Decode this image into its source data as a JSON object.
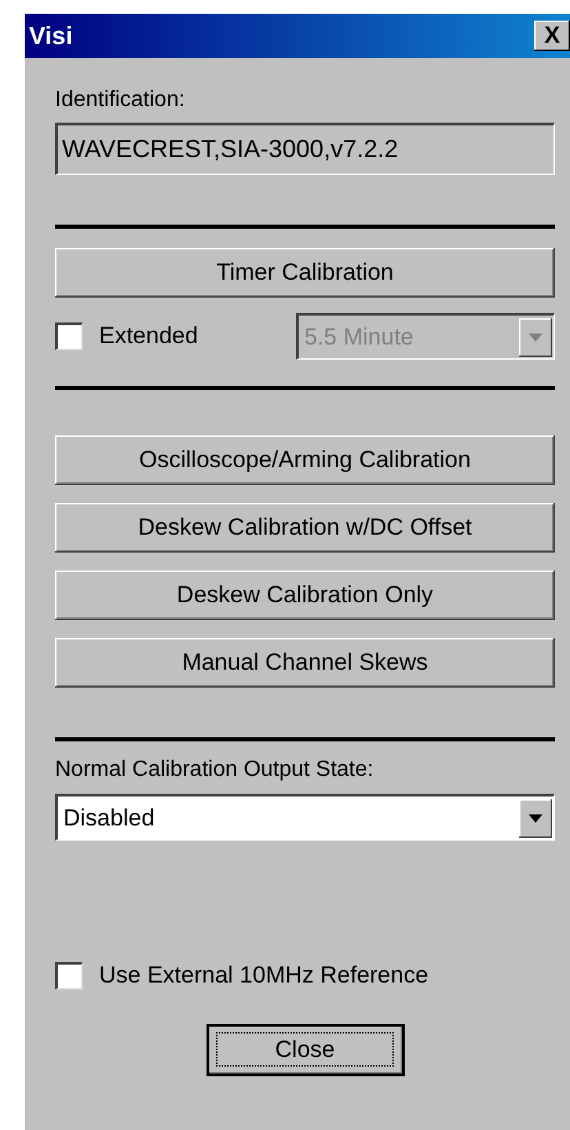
{
  "window": {
    "title": "Visi",
    "close_glyph": "X"
  },
  "identification": {
    "label": "Identification:",
    "value": "WAVECREST,SIA-3000,v7.2.2"
  },
  "timer_button": "Timer Calibration",
  "extended": {
    "label": "Extended",
    "checked": false
  },
  "duration": {
    "value": "5.5 Minute",
    "disabled": true
  },
  "calibration_buttons": [
    "Oscilloscope/Arming Calibration",
    "Deskew Calibration w/DC Offset",
    "Deskew Calibration Only",
    "Manual Channel Skews"
  ],
  "output_state": {
    "label": "Normal Calibration Output State:",
    "value": "Disabled",
    "disabled": false
  },
  "external_reference": {
    "label": "Use External 10MHz Reference",
    "checked": false
  },
  "close_button": {
    "label": "Close",
    "focused": true
  }
}
